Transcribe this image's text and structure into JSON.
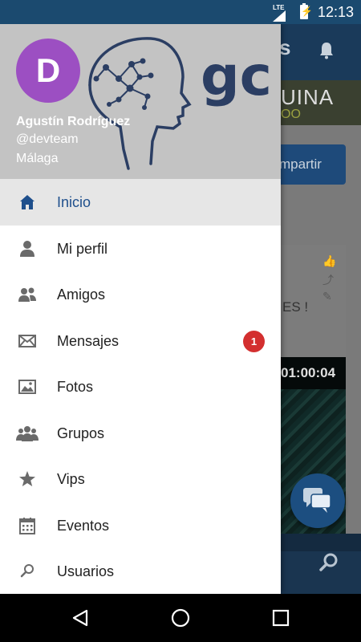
{
  "status_bar": {
    "network": "LTE",
    "time": "12:13"
  },
  "background": {
    "title_fragment": "s",
    "banner_main": "UINA",
    "banner_sub": "OO",
    "share_button": "mpartir",
    "post_text": "ES !",
    "video_time": "01:00:04"
  },
  "user": {
    "initial": "D",
    "name": "Agustín Rodríguez",
    "handle": "@devteam",
    "location": "Málaga"
  },
  "logo": {
    "text": "gc"
  },
  "menu": [
    {
      "label": "Inicio",
      "icon": "home-icon",
      "active": true
    },
    {
      "label": "Mi perfil",
      "icon": "person-icon"
    },
    {
      "label": "Amigos",
      "icon": "friends-icon"
    },
    {
      "label": "Mensajes",
      "icon": "envelope-icon",
      "badge": "1"
    },
    {
      "label": "Fotos",
      "icon": "photo-icon"
    },
    {
      "label": "Grupos",
      "icon": "group-icon"
    },
    {
      "label": "Vips",
      "icon": "star-icon"
    },
    {
      "label": "Eventos",
      "icon": "calendar-icon"
    },
    {
      "label": "Usuarios",
      "icon": "search-icon"
    }
  ],
  "colors": {
    "accent": "#1e4f8c",
    "avatar": "#9c4fc2",
    "badge": "#d32f2f",
    "header_bg": "#c3c3c3"
  }
}
